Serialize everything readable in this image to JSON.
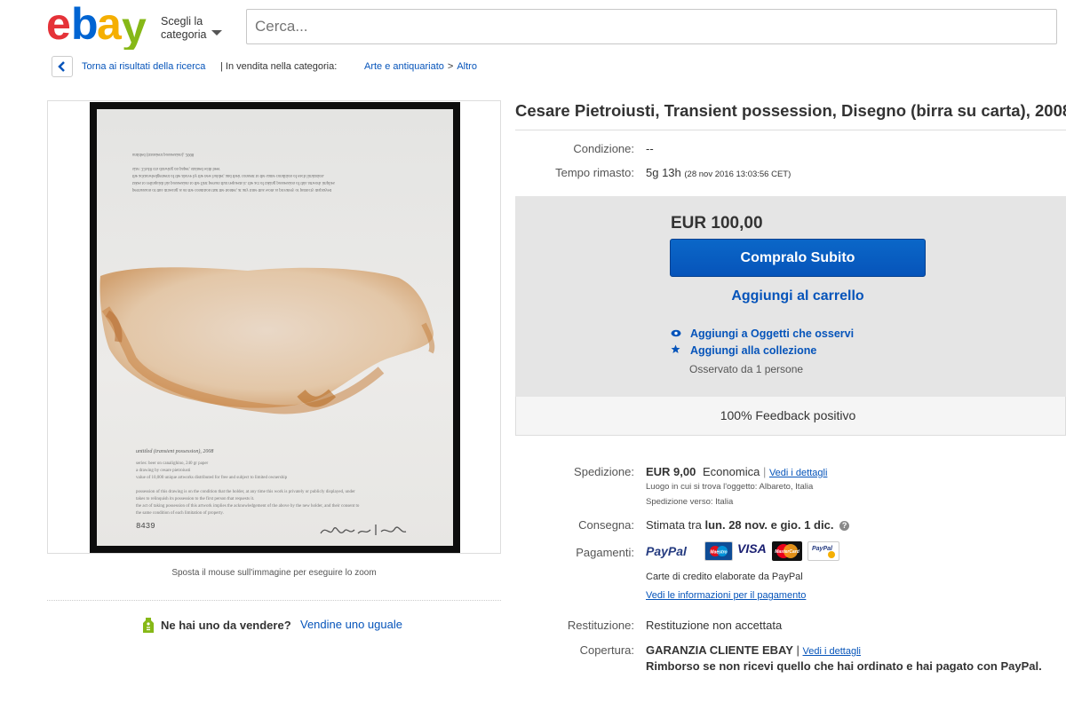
{
  "header": {
    "logo_letters": [
      "e",
      "b",
      "a",
      "y"
    ],
    "category_label_line1": "Scegli la",
    "category_label_line2": "categoria",
    "search_placeholder": "Cerca..."
  },
  "breadcrumb": {
    "back_label": "Torna ai risultati della ricerca",
    "in_category": "| In vendita nella categoria:",
    "category": "Arte e antiquariato",
    "separator": ">",
    "subcategory": "Altro"
  },
  "image": {
    "zoom_hint": "Sposta il mouse sull'immagine per eseguire lo zoom",
    "artwork_caption": "untitled (transient possession), 2008",
    "artwork_number": "8439"
  },
  "sell_one": {
    "question": "Ne hai uno da vendere?",
    "link": "Vendine uno uguale"
  },
  "item": {
    "title": "Cesare Pietroiusti, Transient possession, Disegno (birra su carta), 2008",
    "condition_label": "Condizione:",
    "condition_value": "--",
    "time_label": "Tempo rimasto:",
    "time_value": "5g 13h",
    "time_end": "(28 nov 2016   13:03:56 CET)"
  },
  "buy_box": {
    "price": "EUR 100,00",
    "buy_now": "Compralo Subito",
    "add_to_cart": "Aggiungi al carrello",
    "watch": "Aggiungi a Oggetti che osservi",
    "collection": "Aggiungi alla collezione",
    "watchers": "Osservato da 1 persone",
    "feedback": "100% Feedback positivo"
  },
  "details": {
    "shipping_label": "Spedizione:",
    "shipping_price": "EUR 9,00",
    "shipping_type": "Economica",
    "shipping_sep": "|",
    "shipping_details_link": "Vedi i dettagli",
    "item_location": "Luogo in cui si trova l'oggetto: Albareto, Italia",
    "ships_to": "Spedizione verso:  Italia",
    "delivery_label": "Consegna:",
    "delivery_prefix": "Stimata tra",
    "delivery_dates": "lun. 28 nov. e gio. 1 dic.",
    "payments_label": "Pagamenti:",
    "paypal_logo": "PayPal",
    "card_names": [
      "Maestro",
      "VISA",
      "MasterCard",
      "PayPal"
    ],
    "cards_note": "Carte di credito elaborate da PayPal",
    "payment_info_link": "Vedi le informazioni per il pagamento",
    "returns_label": "Restituzione:",
    "returns_value": "Restituzione non accettata",
    "coverage_label": "Copertura:",
    "coverage_title": "GARANZIA CLIENTE EBAY",
    "coverage_sep": "|",
    "coverage_link": "Vedi i dettagli",
    "coverage_text": "Rimborso se non ricevi quello che hai ordinato e hai pagato con PayPal."
  },
  "colors": {
    "ebay_e": "#e53238",
    "ebay_b": "#0064d2",
    "ebay_a": "#f5af02",
    "ebay_y": "#86b817",
    "link": "#0654ba",
    "buy_button": "#0654ba"
  }
}
